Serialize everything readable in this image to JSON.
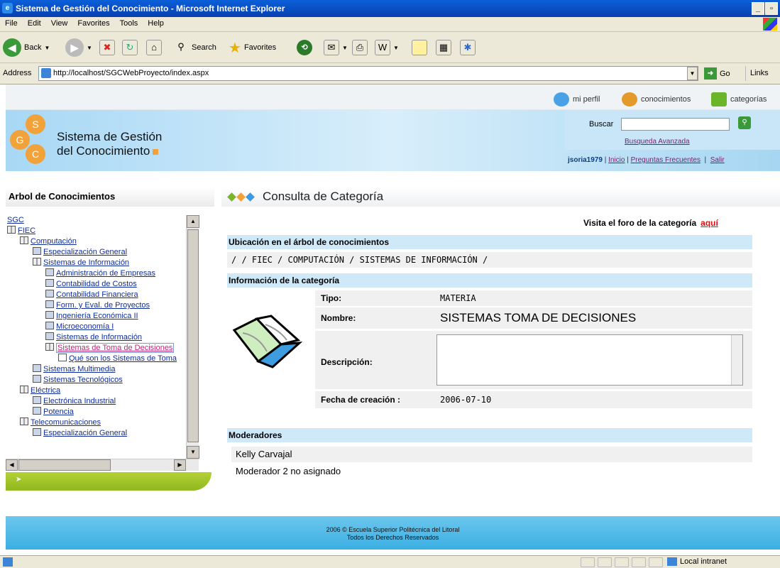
{
  "browser": {
    "title": "Sistema de Gestión del Conocimiento - Microsoft Internet Explorer",
    "menu": [
      "File",
      "Edit",
      "View",
      "Favorites",
      "Tools",
      "Help"
    ],
    "toolbar": {
      "back": "Back",
      "search": "Search",
      "favorites": "Favorites"
    },
    "address_label": "Address",
    "url": "http://localhost/SGCWebProyecto/index.aspx",
    "go": "Go",
    "links": "Links",
    "status_zone": "Local intranet"
  },
  "topnav": {
    "perfil": "mi perfil",
    "conocimientos": "conocimientos",
    "categorias": "categorías"
  },
  "header": {
    "logo_letters": [
      "S",
      "G",
      "C"
    ],
    "brand_line1": "Sistema de Gestión",
    "brand_line2": "del Conocimiento",
    "search_label": "Buscar",
    "search_value": "",
    "advanced": "Busqueda Avanzada",
    "user": "jsoria1979",
    "links": [
      "Inicio",
      "Preguntas Frecuentes",
      "Salir"
    ]
  },
  "sidebar": {
    "title": "Arbol de Conocimientos",
    "tree": [
      {
        "label": "SGC",
        "level": 0,
        "icon": "none"
      },
      {
        "label": "FIEC",
        "level": 0,
        "icon": "book"
      },
      {
        "label": "Computación",
        "level": 1,
        "icon": "book"
      },
      {
        "label": "Especialización General",
        "level": 2,
        "icon": "leaf"
      },
      {
        "label": "Sistemas de Información",
        "level": 2,
        "icon": "book"
      },
      {
        "label": "Administración de Empresas",
        "level": 3,
        "icon": "leaf"
      },
      {
        "label": "Contabilidad de Costos",
        "level": 3,
        "icon": "leaf"
      },
      {
        "label": "Contabilidad Financiera",
        "level": 3,
        "icon": "leaf"
      },
      {
        "label": "Form. y Eval. de Proyectos",
        "level": 3,
        "icon": "leaf"
      },
      {
        "label": "Ingeniería Económica II",
        "level": 3,
        "icon": "leaf"
      },
      {
        "label": "Microeconomía I",
        "level": 3,
        "icon": "leaf"
      },
      {
        "label": "Sistemas de Información",
        "level": 3,
        "icon": "leaf"
      },
      {
        "label": "Sistemas de Toma de Decisiones",
        "level": 3,
        "icon": "book",
        "selected": true
      },
      {
        "label": "Qué son los Sistemas de Toma",
        "level": 4,
        "icon": "doc"
      },
      {
        "label": "Sistemas Multimedia",
        "level": 2,
        "icon": "leaf"
      },
      {
        "label": "Sistemas Tecnológicos",
        "level": 2,
        "icon": "leaf"
      },
      {
        "label": "Eléctrica",
        "level": 1,
        "icon": "book"
      },
      {
        "label": "Electrónica Industrial",
        "level": 2,
        "icon": "leaf"
      },
      {
        "label": "Potencia",
        "level": 2,
        "icon": "leaf"
      },
      {
        "label": "Telecomunicaciones",
        "level": 1,
        "icon": "book"
      },
      {
        "label": "Especialización General",
        "level": 2,
        "icon": "leaf"
      }
    ]
  },
  "main": {
    "title": "Consulta de Categoría",
    "foro_text": "Visita el foro de la categoría",
    "foro_link": "aquí",
    "ubicacion_head": "Ubicación en el árbol de conocimientos",
    "ubicacion": "/ / FIEC / COMPUTACIÓN / SISTEMAS DE INFORMACIÓN /",
    "info_head": "Información de la categoría",
    "tipo_label": "Tipo:",
    "tipo": "MATERIA",
    "nombre_label": "Nombre:",
    "nombre": "SISTEMAS TOMA DE DECISIONES",
    "descripcion_label": "Descripción:",
    "descripcion": "",
    "fecha_label": "Fecha de creación :",
    "fecha": "2006-07-10",
    "moderadores_head": "Moderadores",
    "moderadores": [
      "Kelly Carvajal",
      "Moderador 2 no asignado"
    ]
  },
  "footer": {
    "line1": "2006 © Escuela Superior Politécnica del Litoral",
    "line2": "Todos los Derechos Reservados"
  }
}
